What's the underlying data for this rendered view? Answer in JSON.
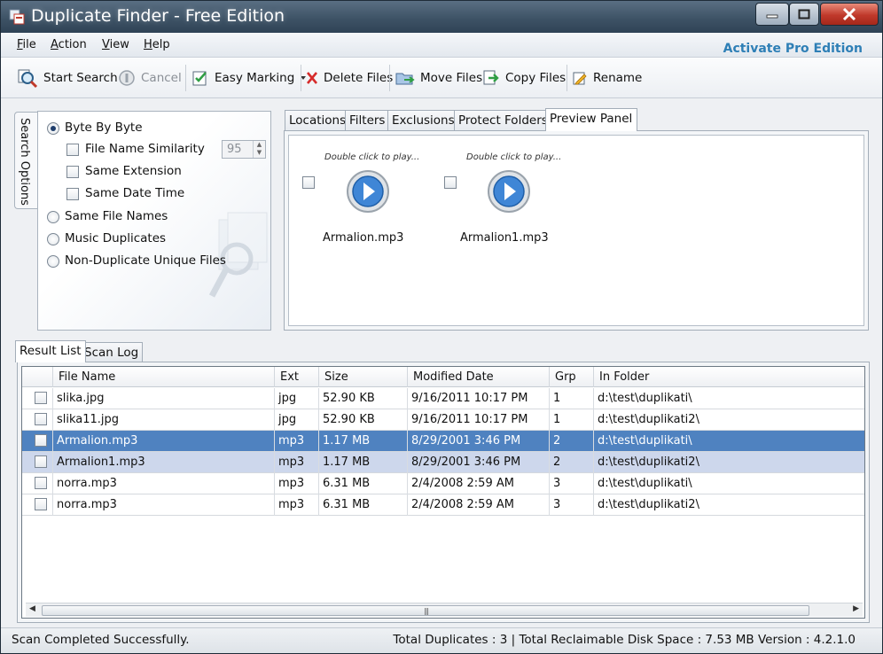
{
  "window": {
    "title": "Duplicate Finder - Free Edition"
  },
  "menu": {
    "items": [
      {
        "label": "File",
        "accel": "F",
        "rest": "ile"
      },
      {
        "label": "Action",
        "accel": "A",
        "rest": "ction"
      },
      {
        "label": "View",
        "accel": "V",
        "rest": "iew"
      },
      {
        "label": "Help",
        "accel": "H",
        "rest": "elp"
      }
    ],
    "activate_pro": "Activate Pro Edition"
  },
  "toolbar": {
    "start_search": "Start Search",
    "cancel": "Cancel",
    "easy_marking": "Easy Marking",
    "delete_files": "Delete Files",
    "move_files": "Move Files",
    "copy_files": "Copy Files",
    "rename": "Rename"
  },
  "search_options": {
    "tab_label": "Search Options",
    "options": [
      {
        "label": "Byte By Byte",
        "kind": "radio",
        "checked": true
      },
      {
        "label": "File Name Similarity",
        "kind": "checkbox",
        "checked": false
      },
      {
        "label": "Same Extension",
        "kind": "checkbox",
        "checked": false
      },
      {
        "label": "Same Date Time",
        "kind": "checkbox",
        "checked": false
      },
      {
        "label": "Same File Names",
        "kind": "radio",
        "checked": false
      },
      {
        "label": "Music Duplicates",
        "kind": "radio",
        "checked": false
      },
      {
        "label": "Non-Duplicate Unique Files",
        "kind": "radio",
        "checked": false
      }
    ],
    "similarity_value": "95"
  },
  "preview": {
    "tabs": [
      "Locations",
      "Filters",
      "Exclusions",
      "Protect Folders",
      "Preview Panel"
    ],
    "active_tab": "Preview Panel",
    "items": [
      {
        "hint": "Double click to play...",
        "file": "Armalion.mp3"
      },
      {
        "hint": "Double click to play...",
        "file": "Armalion1.mp3"
      }
    ]
  },
  "results": {
    "tabs": [
      "Result List",
      "Scan Log"
    ],
    "active_tab": "Result List",
    "columns": [
      "File Name",
      "Ext",
      "Size",
      "Modified Date",
      "Grp",
      "In Folder"
    ],
    "rows": [
      {
        "name": "slika.jpg",
        "ext": "jpg",
        "size": "52.90 KB",
        "date": "9/16/2011 10:17 PM",
        "grp": "1",
        "folder": "d:\\test\\duplikati\\",
        "state": "normal"
      },
      {
        "name": "slika11.jpg",
        "ext": "jpg",
        "size": "52.90 KB",
        "date": "9/16/2011 10:17 PM",
        "grp": "1",
        "folder": "d:\\test\\duplikati2\\",
        "state": "normal"
      },
      {
        "name": "Armalion.mp3",
        "ext": "mp3",
        "size": "1.17 MB",
        "date": "8/29/2001 3:46 PM",
        "grp": "2",
        "folder": "d:\\test\\duplikati\\",
        "state": "selected"
      },
      {
        "name": "Armalion1.mp3",
        "ext": "mp3",
        "size": "1.17 MB",
        "date": "8/29/2001 3:46 PM",
        "grp": "2",
        "folder": "d:\\test\\duplikati2\\",
        "state": "hover"
      },
      {
        "name": "norra.mp3",
        "ext": "mp3",
        "size": "6.31 MB",
        "date": "2/4/2008 2:59 AM",
        "grp": "3",
        "folder": "d:\\test\\duplikati\\",
        "state": "normal"
      },
      {
        "name": "norra.mp3",
        "ext": "mp3",
        "size": "6.31 MB",
        "date": "2/4/2008 2:59 AM",
        "grp": "3",
        "folder": "d:\\test\\duplikati2\\",
        "state": "normal"
      }
    ]
  },
  "status": {
    "left": "Scan Completed Successfully.",
    "right": "Total Duplicates : 3 | Total Reclaimable Disk Space : 7.53 MB  Version : 4.2.1.0"
  },
  "colors": {
    "accent": "#2e7fb6",
    "selection": "#4f82c0",
    "hover": "#cdd7ec"
  }
}
